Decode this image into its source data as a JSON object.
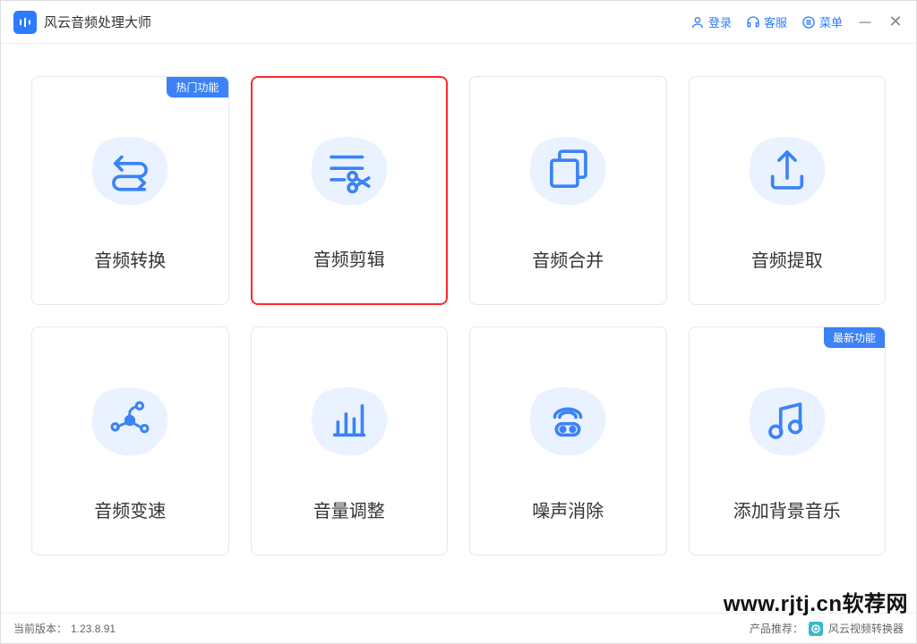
{
  "app": {
    "title": "风云音频处理大师"
  },
  "header": {
    "login": "登录",
    "support": "客服",
    "menu": "菜单"
  },
  "badges": {
    "hot": "热门功能",
    "new": "最新功能"
  },
  "cards": [
    {
      "label": "音频转换"
    },
    {
      "label": "音频剪辑"
    },
    {
      "label": "音频合并"
    },
    {
      "label": "音频提取"
    },
    {
      "label": "音频变速"
    },
    {
      "label": "音量调整"
    },
    {
      "label": "噪声消除"
    },
    {
      "label": "添加背景音乐"
    }
  ],
  "footer": {
    "version_label": "当前版本：",
    "version": "1.23.8.91",
    "recommend_label": "产品推荐：",
    "recommend_product": "风云视频转换器"
  },
  "watermark": "www.rjtj.cn软荐网"
}
